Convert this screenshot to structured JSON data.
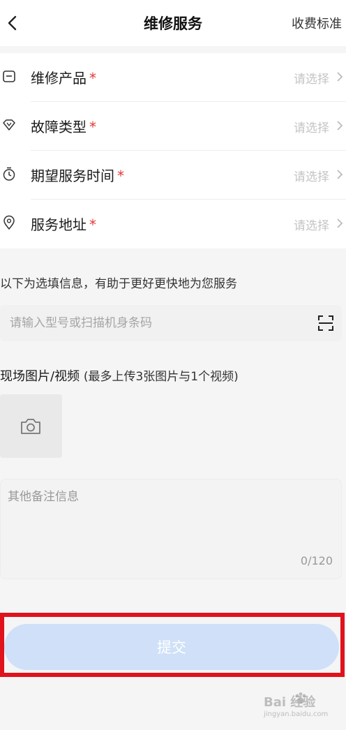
{
  "header": {
    "title": "维修服务",
    "fee_link": "收费标准"
  },
  "form": {
    "rows": [
      {
        "label": "维修产品",
        "required_mark": "*",
        "value": "请选择",
        "icon": "product-box-icon"
      },
      {
        "label": "故障类型",
        "required_mark": "*",
        "value": "请选择",
        "icon": "diamond-icon"
      },
      {
        "label": "期望服务时间",
        "required_mark": "*",
        "value": "请选择",
        "icon": "timer-icon"
      },
      {
        "label": "服务地址",
        "required_mark": "*",
        "value": "请选择",
        "icon": "location-pin-icon"
      }
    ]
  },
  "optional_hint": "以下为选填信息，有助于更好更快地为您服务",
  "model_input": {
    "placeholder": "请输入型号或扫描机身条码",
    "value": ""
  },
  "media": {
    "label": "现场图片/视频",
    "note": "(最多上传3张图片与1个视频)"
  },
  "remark": {
    "placeholder": "其他备注信息",
    "counter": "0/120"
  },
  "submit_label": "提交",
  "watermark": {
    "main": "Bai  经验",
    "sub": "jingyan.baidu.com"
  },
  "colors": {
    "required": "#e53935",
    "submit_bg": "#cfe0f8",
    "highlight": "#e0121b"
  }
}
